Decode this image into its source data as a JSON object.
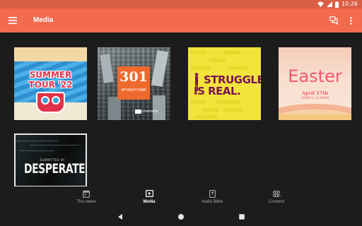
{
  "status_bar": {
    "time": "10:26",
    "icons": [
      "wifi-icon",
      "signal-icon",
      "battery-icon"
    ]
  },
  "app_bar": {
    "title": "Media",
    "color": "#f26b4f",
    "icons": [
      "menu-icon",
      "chat-icon",
      "more-vert-icon"
    ]
  },
  "media": [
    {
      "name": "summer-tour",
      "lines": [
        "SUMMER",
        "TOUR '22"
      ],
      "top_text": "",
      "colors": [
        "#3fa3d9",
        "#e2324a",
        "#f2d8a4"
      ]
    },
    {
      "name": "forum-town",
      "number": "301",
      "tag": "#FORUPTOWN",
      "logo": "charlotte"
    },
    {
      "name": "struggle-is-real",
      "lines": [
        "STRUGGLE",
        "IS REAL."
      ],
      "bg_words": [
        "FOOD",
        "WORK",
        "HOME",
        "FAMILY",
        "MONEY",
        "FRIENDS",
        "LOVE",
        "HOME",
        "FAMILY",
        "SCHOOL"
      ]
    },
    {
      "name": "easter",
      "title": "Easter",
      "date": "April 17th",
      "times": "10AM & 11:30AM"
    },
    {
      "name": "desperate",
      "subtitle": "SUBMITTED BY",
      "title": "DESPERATE"
    }
  ],
  "bottom_nav": {
    "items": [
      {
        "label": "This week",
        "icon": "calendar-icon",
        "active": false
      },
      {
        "label": "Media",
        "icon": "play-icon",
        "active": true
      },
      {
        "label": "Audio Bible",
        "icon": "book-icon",
        "active": false
      },
      {
        "label": "Connect",
        "icon": "people-icon",
        "active": false
      }
    ]
  },
  "system_nav": [
    "back-icon",
    "home-icon",
    "recents-icon"
  ]
}
